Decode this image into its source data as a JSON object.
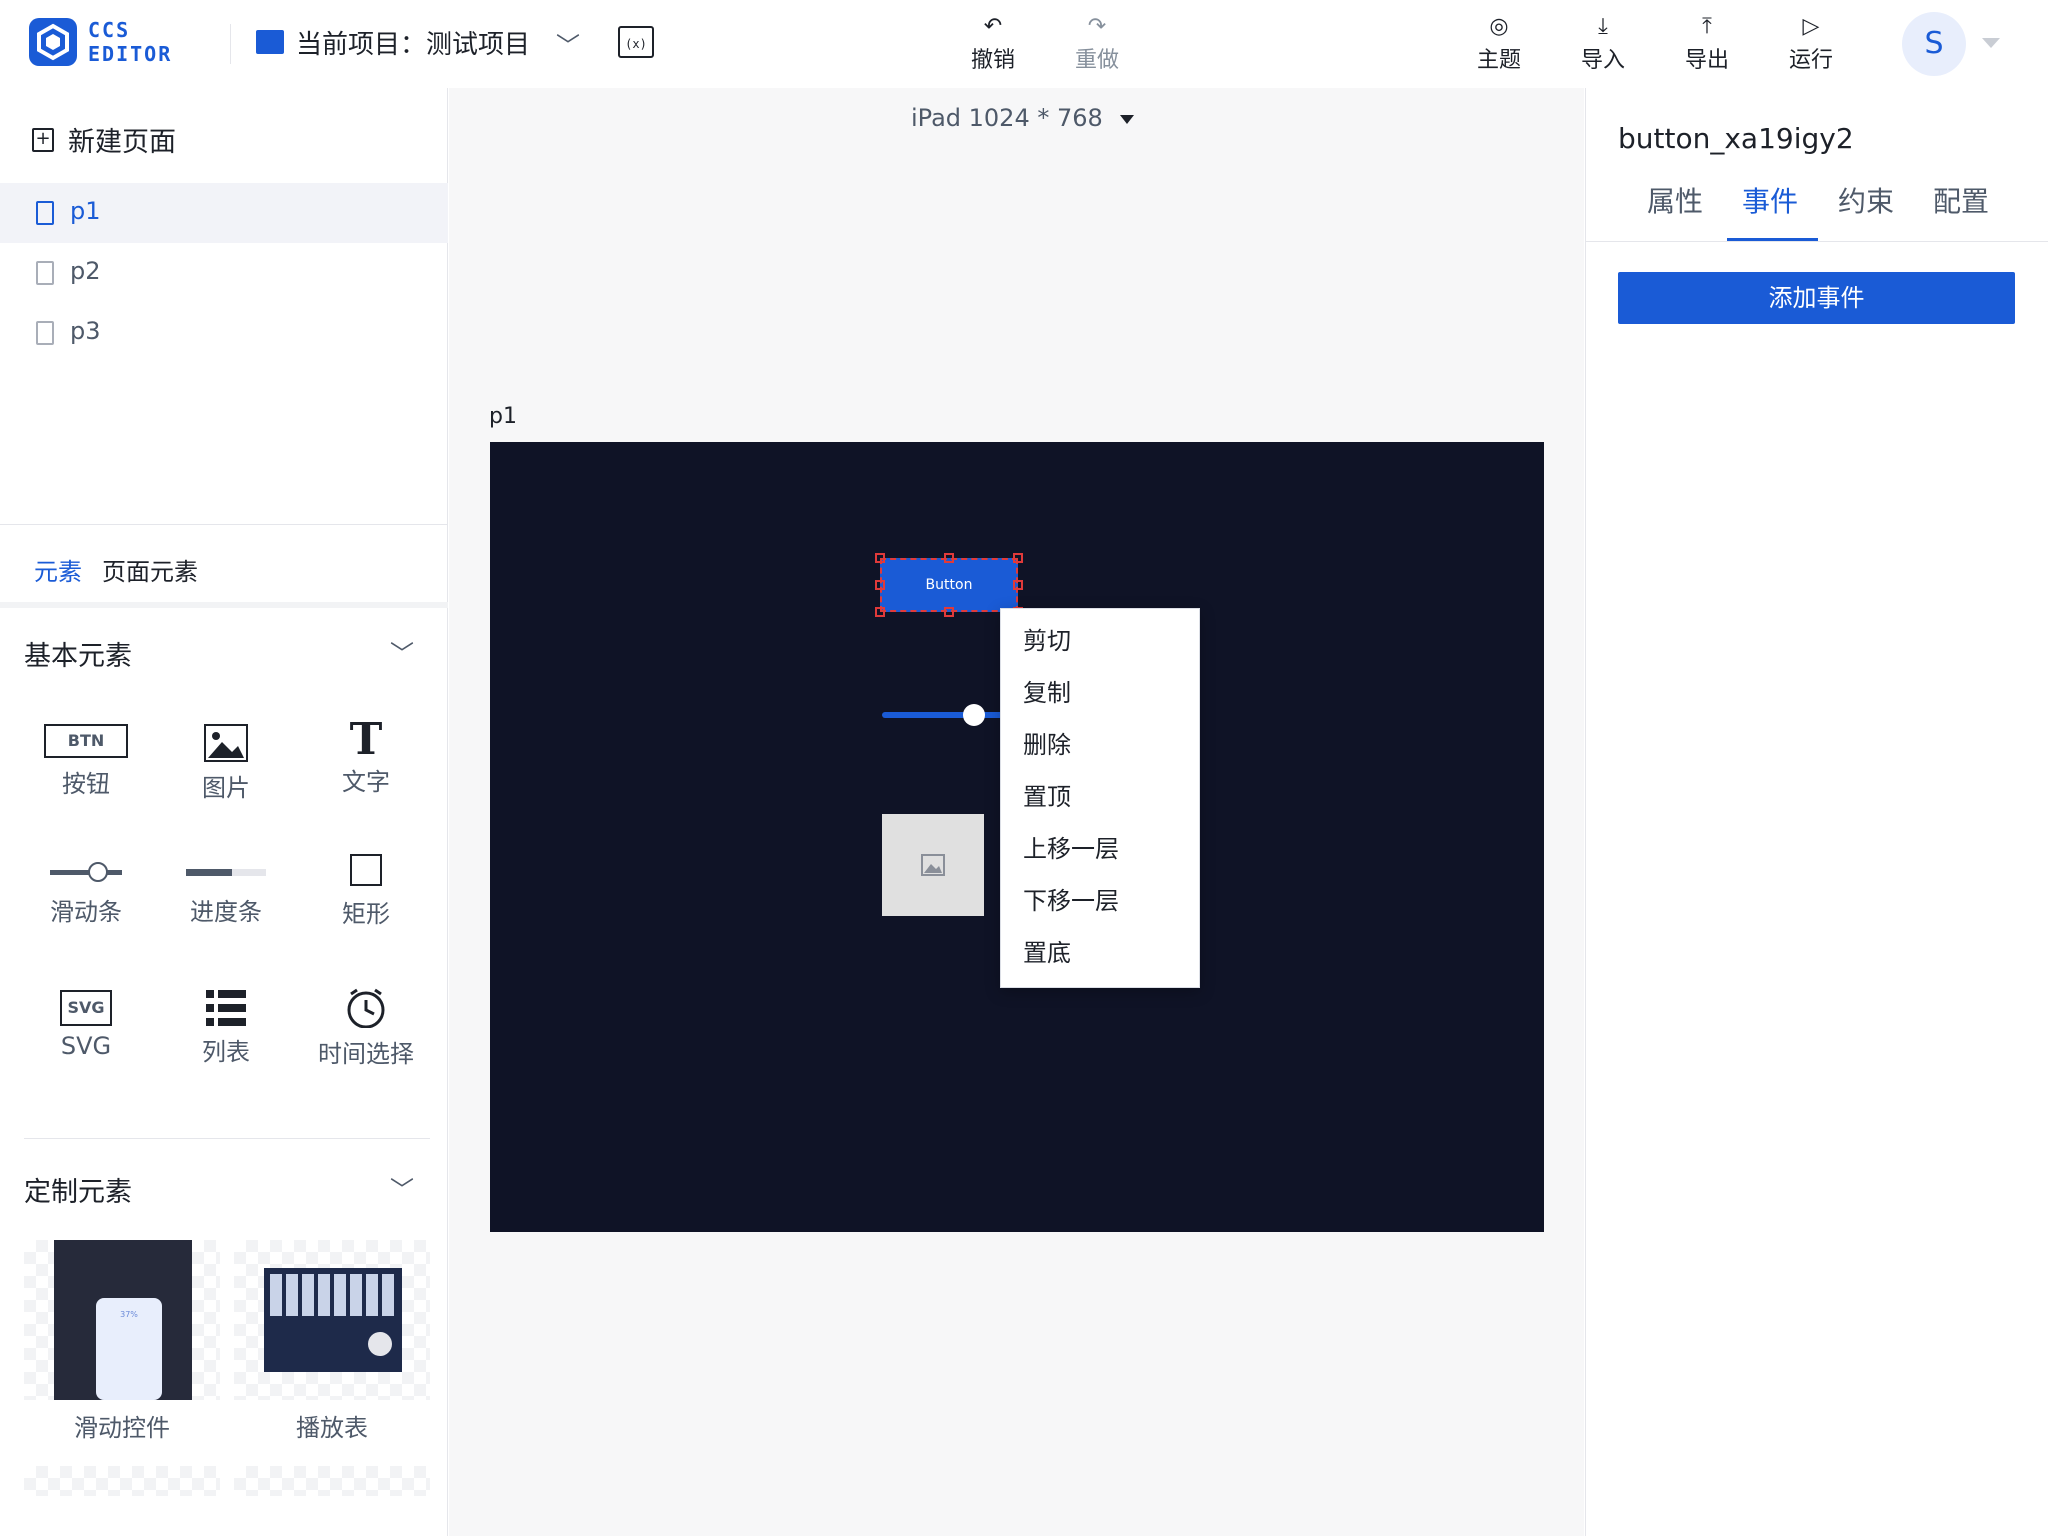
{
  "app": {
    "logo_line1": "CCS",
    "logo_line2": "EDITOR",
    "project_prefix": "当前项目：",
    "project_name": "测试项目"
  },
  "toolbar": {
    "undo": "撤销",
    "redo": "重做",
    "theme": "主题",
    "import": "导入",
    "export": "导出",
    "run": "运行",
    "avatar_initial": "S"
  },
  "pages": {
    "new_page": "新建页面",
    "items": [
      "p1",
      "p2",
      "p3"
    ],
    "active": "p1"
  },
  "elements_panel": {
    "tabs": [
      "元素",
      "页面元素"
    ],
    "basic_title": "基本元素",
    "basic_items": [
      {
        "label": "按钮",
        "icon": "BTN"
      },
      {
        "label": "图片",
        "icon": "image-icon"
      },
      {
        "label": "文字",
        "icon": "T"
      },
      {
        "label": "滑动条",
        "icon": "slider-icon"
      },
      {
        "label": "进度条",
        "icon": "progress-icon"
      },
      {
        "label": "矩形",
        "icon": "rect-icon"
      },
      {
        "label": "SVG",
        "icon": "SVG"
      },
      {
        "label": "列表",
        "icon": "list-icon"
      },
      {
        "label": "时间选择",
        "icon": "clock-icon"
      }
    ],
    "custom_title": "定制元素",
    "custom_items": [
      "滑动控件",
      "播放表"
    ],
    "thumb_percent": "37%"
  },
  "canvas": {
    "device": "iPad 1024 * 768",
    "page_label": "p1",
    "button_text": "Button"
  },
  "context_menu": {
    "items": [
      "剪切",
      "复制",
      "删除",
      "置顶",
      "上移一层",
      "下移一层",
      "置底"
    ]
  },
  "inspector": {
    "component_id": "button_xa19igy2",
    "tabs": [
      "属性",
      "事件",
      "约束",
      "配置"
    ],
    "active_tab": "事件",
    "add_event": "添加事件"
  },
  "colors": {
    "accent": "#1a5bd6",
    "canvas_bg": "#0f1326"
  }
}
